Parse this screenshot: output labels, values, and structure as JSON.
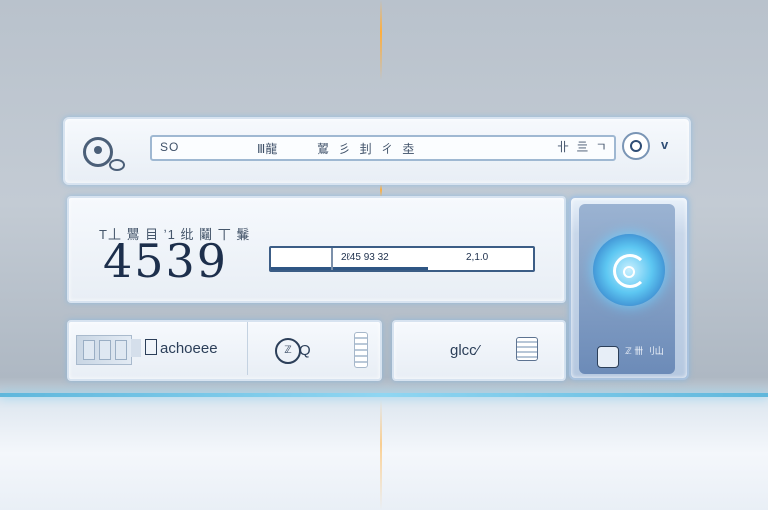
{
  "search": {
    "value": "SO",
    "chars_a": "Ⅲ龍",
    "chars_b": "鶦 彡 刲 ㄔ 坴",
    "chars_right": "卝 亖 ㄱ"
  },
  "main": {
    "subtitle": "T丄 鸎 目 ʼ1 纰 鬮 丅 鬑",
    "big_number": "4539",
    "range_label_left": "2ℓ45 93 32",
    "range_label_right": "2,1.0",
    "range_fill_fraction": 0.6
  },
  "bottom_left": {
    "choose_label": "achoeee",
    "q_logo_text": "ℤ",
    "q_text": "Q"
  },
  "bottom_middle": {
    "label": "glcc⁄"
  },
  "right_panel": {
    "badge_text": "ℤ 卌 刂山"
  },
  "icons": [
    "search-logo-icon",
    "mic-icon",
    "chevron-down-icon",
    "toggle-icon",
    "document-icon",
    "list-icon",
    "refresh-glow-icon",
    "badge-icon"
  ],
  "colors": {
    "accent": "#5dc7f2",
    "text_dark": "#1d2f4c",
    "beam": "#ffae3c",
    "glowline": "#7fd0f0"
  }
}
